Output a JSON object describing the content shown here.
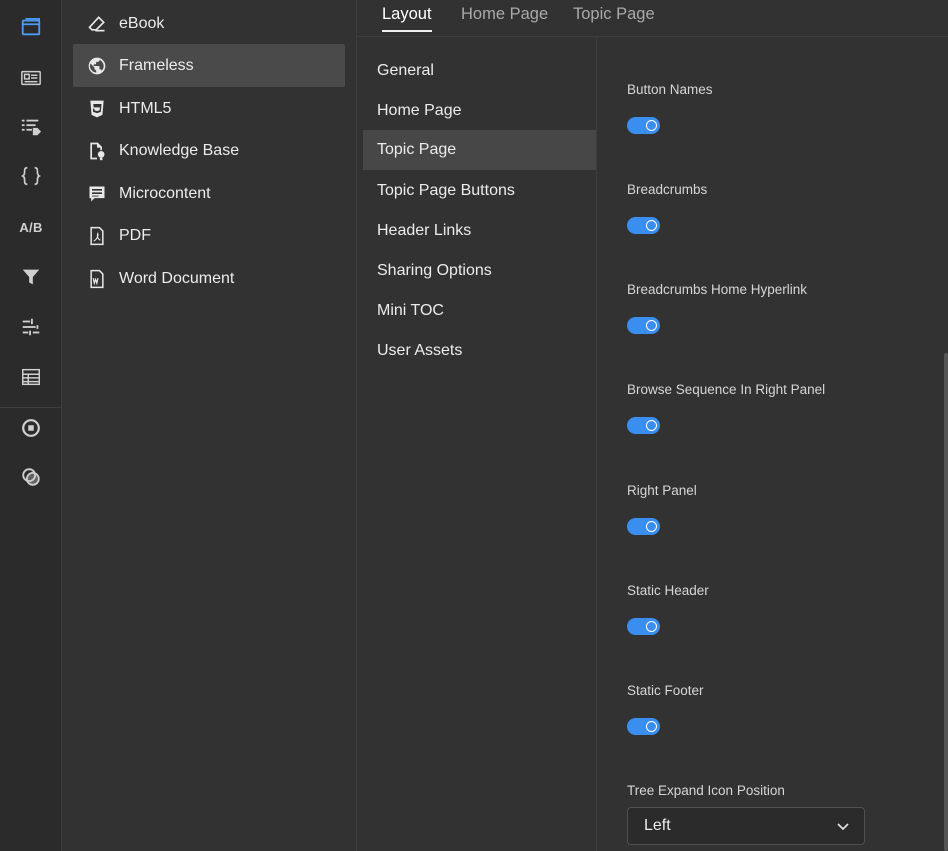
{
  "rail": {
    "icons": [
      "window-icon",
      "output-list-icon",
      "tags-icon",
      "braces-icon",
      "ab-test-icon",
      "filter-icon",
      "sliders-icon",
      "table-icon",
      "stop-icon",
      "overlap-icon"
    ],
    "ab_label": "A/B"
  },
  "outputs": {
    "items": [
      {
        "label": "eBook",
        "icon": "eraser-icon"
      },
      {
        "label": "Frameless",
        "icon": "globe-icon"
      },
      {
        "label": "HTML5",
        "icon": "html5-icon"
      },
      {
        "label": "Knowledge Base",
        "icon": "knowledge-base-icon"
      },
      {
        "label": "Microcontent",
        "icon": "comment-icon"
      },
      {
        "label": "PDF",
        "icon": "pdf-icon"
      },
      {
        "label": "Word Document",
        "icon": "word-icon"
      }
    ],
    "active_index": 1
  },
  "tabs": {
    "items": [
      "Layout",
      "Home Page",
      "Topic Page"
    ],
    "active_index": 0
  },
  "subnav": {
    "items": [
      "General",
      "Home Page",
      "Topic Page",
      "Topic Page Buttons",
      "Header Links",
      "Sharing Options",
      "Mini TOC",
      "User Assets"
    ],
    "active_index": 2
  },
  "settings": {
    "toggles": [
      {
        "label": "Button Names",
        "on": true
      },
      {
        "label": "Breadcrumbs",
        "on": true
      },
      {
        "label": "Breadcrumbs Home Hyperlink",
        "on": true
      },
      {
        "label": "Browse Sequence In Right Panel",
        "on": true
      },
      {
        "label": "Right Panel",
        "on": true
      },
      {
        "label": "Static Header",
        "on": true
      },
      {
        "label": "Static Footer",
        "on": true
      }
    ],
    "tree_expand": {
      "label": "Tree Expand Icon Position",
      "value": "Left"
    }
  },
  "colors": {
    "accent": "#3a8ef0",
    "background": "#323232",
    "rail": "#2b2b2b",
    "active_item": "#4a4a4a"
  }
}
